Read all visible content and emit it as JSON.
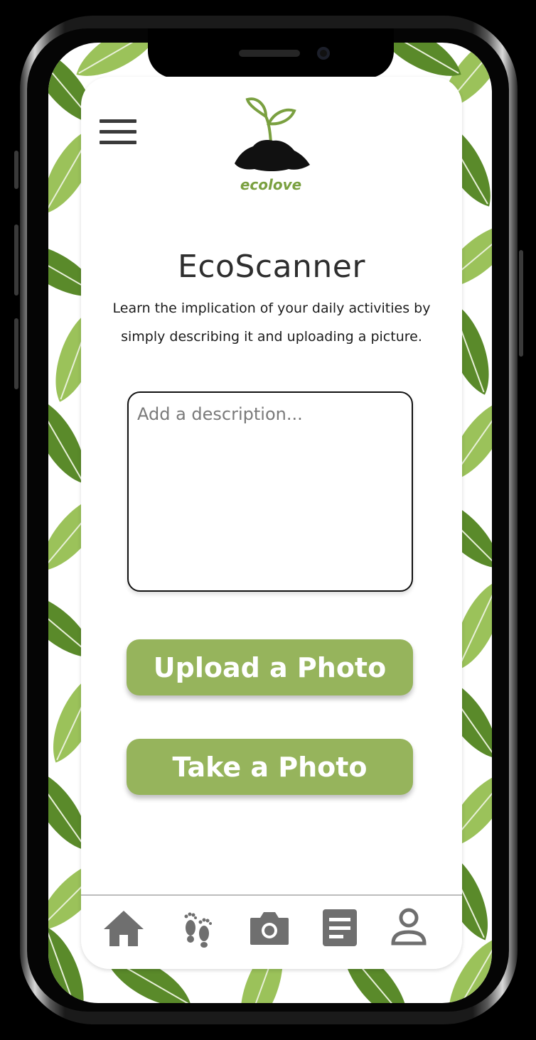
{
  "app": {
    "logo_text": "ecolove"
  },
  "header": {
    "menu_icon": "hamburger-icon"
  },
  "main": {
    "title": "EcoScanner",
    "subtitle": "Learn the implication of your daily activities by simply describing it and uploading a picture.",
    "description_placeholder": "Add a description...",
    "upload_button": "Upload a Photo",
    "take_button": "Take a Photo"
  },
  "nav": {
    "items": [
      {
        "icon": "home-icon"
      },
      {
        "icon": "footprints-icon"
      },
      {
        "icon": "camera-icon"
      },
      {
        "icon": "document-icon"
      },
      {
        "icon": "user-icon"
      }
    ]
  },
  "colors": {
    "accent": "#96b45c",
    "logo_green": "#7aa040",
    "leaf_dark": "#5a8a2a",
    "leaf_light": "#9bc25a"
  }
}
